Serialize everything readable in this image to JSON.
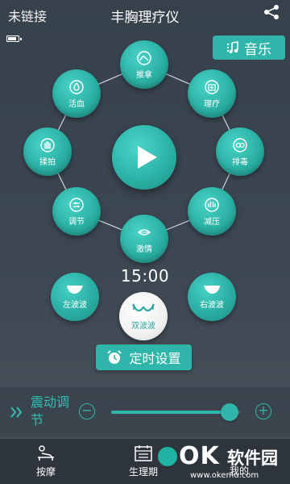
{
  "header": {
    "connection_status": "未链接",
    "title": "丰胸理疗仪"
  },
  "battery": {
    "level": 0.7
  },
  "music_button": {
    "label": "音乐",
    "icon": "music-note-icon"
  },
  "modes": [
    {
      "key": "tuina",
      "label": "推拿",
      "icon": "massage-icon"
    },
    {
      "key": "liliao",
      "label": "理疗",
      "icon": "medical-kit-icon"
    },
    {
      "key": "paidu",
      "label": "排毒",
      "icon": "detox-icon"
    },
    {
      "key": "jianya",
      "label": "减压",
      "icon": "relax-icon"
    },
    {
      "key": "jiqing",
      "label": "激情",
      "icon": "lips-icon"
    },
    {
      "key": "tiaojie",
      "label": "调节",
      "icon": "adjust-icon"
    },
    {
      "key": "roupai",
      "label": "揉拍",
      "icon": "hand-icon"
    },
    {
      "key": "huoxue",
      "label": "活血",
      "icon": "blood-drop-icon"
    }
  ],
  "timer_display": "15:00",
  "waves": {
    "left": "左波波",
    "both": "双波波",
    "right": "右波波"
  },
  "timer_button": {
    "label": "定时设置",
    "icon": "alarm-clock-icon"
  },
  "vibration": {
    "label": "震动调节",
    "level": 0.92,
    "minus": "−",
    "plus": "+"
  },
  "nav": {
    "massage": "按摩",
    "period": "生理期",
    "mine": "我的"
  },
  "watermark": {
    "brand": "OK",
    "name": "软件园",
    "url": "www.okemu.com"
  },
  "colors": {
    "accent": "#2fb5aa",
    "background": "#3a444e"
  }
}
